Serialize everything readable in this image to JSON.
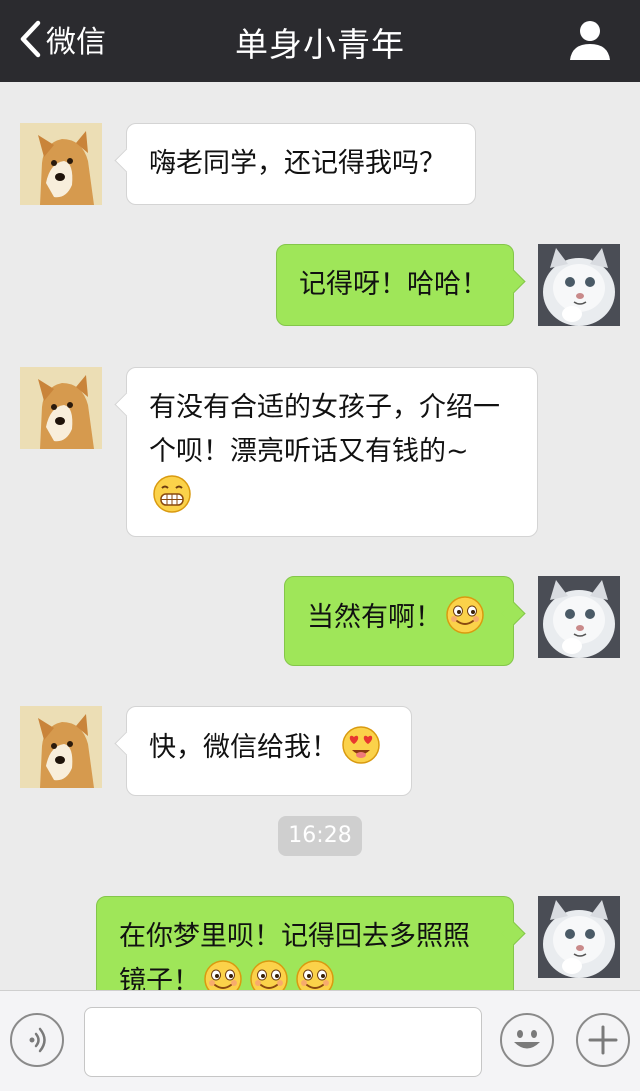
{
  "header": {
    "back_label": "微信",
    "title": "单身小青年"
  },
  "messages": [
    {
      "side": "left",
      "text": "嗨老同学，还记得我吗？"
    },
    {
      "side": "right",
      "text": "记得呀！哈哈！"
    },
    {
      "side": "left",
      "text_line1": "有没有合适的女孩子，介绍一",
      "text_line2": "个呗！漂亮听话又有钱的~",
      "emoji": "grin-emoji"
    },
    {
      "side": "right",
      "text": "当然有啊！",
      "emoji": "smile-emoji"
    },
    {
      "side": "left",
      "text": "快，微信给我！",
      "emoji": "heart-eyes-emoji"
    },
    {
      "side": "right",
      "text_line1": "在你梦里呗！记得回去多照照",
      "text_line2": "镜子！",
      "emoji": "smile-emoji x3"
    }
  ],
  "timestamp": "16:28",
  "input": {
    "value": "",
    "placeholder": ""
  },
  "icons": {
    "voice": "voice-icon",
    "emoji": "emoji-icon",
    "plus": "plus-icon",
    "back": "chevron-left-icon",
    "profile": "person-icon"
  },
  "colors": {
    "header_bg": "#2b2b2f",
    "chat_bg": "#ebebeb",
    "sent_bubble": "#9fe659",
    "received_bubble": "#ffffff"
  }
}
